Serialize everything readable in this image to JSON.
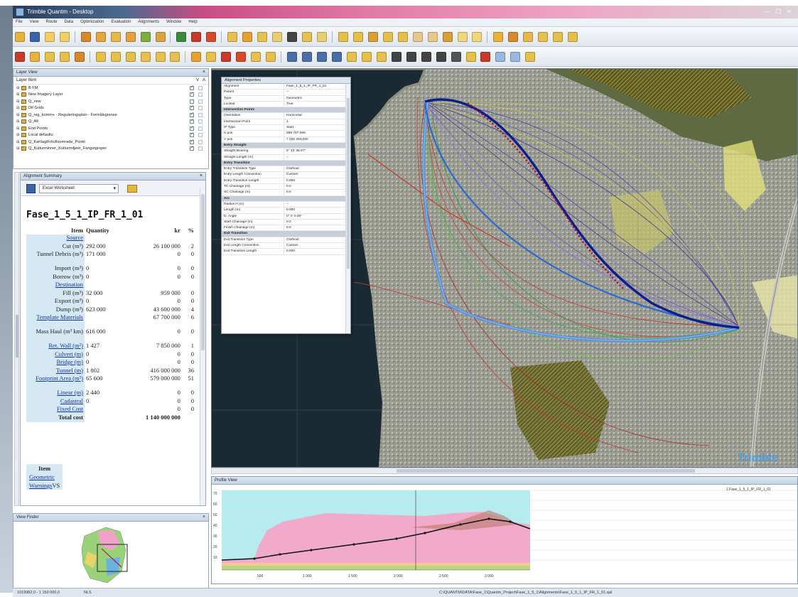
{
  "window": {
    "title": "Trimble Quantm - Desktop"
  },
  "menu": [
    "File",
    "View",
    "Route",
    "Data",
    "Optimization",
    "Evaluation",
    "Alignments",
    "Window",
    "Help"
  ],
  "layer_view": {
    "title": "Layer View",
    "column_header": "Layer Item",
    "column_v": "V",
    "column_a": "A",
    "layers": [
      {
        "name": "B FM",
        "visible": true
      },
      {
        "name": "New Imagery Layer",
        "visible": true
      },
      {
        "name": "Q_new",
        "visible": false
      },
      {
        "name": "Dif Grids",
        "visible": true
      },
      {
        "name": "Q_reg_komm+ - Reguleringsplan - Formålsgrense",
        "visible": true
      },
      {
        "name": "Q_Alt",
        "visible": true
      },
      {
        "name": "End Points",
        "visible": true
      },
      {
        "name": "Local defaults",
        "visible": true
      },
      {
        "name": "Q_KartlagtFriluftsomrade_Punkt",
        "visible": true
      },
      {
        "name": "Q_Kulturminner_Kulturmiljøer_Fangstgroper",
        "visible": true
      }
    ]
  },
  "alignment_summary": {
    "title": "Alignment Summary",
    "export_option": "Excel Worksheet",
    "alignment_name": "Fase_1_5_1_IP_FR_1_01",
    "headers": {
      "item": "Item",
      "quantity": "Quantity",
      "cost": "kr",
      "pct": "%"
    },
    "rows": [
      {
        "label": "Source",
        "link": true,
        "quantity": "",
        "cost": "",
        "pct": ""
      },
      {
        "label": "Cut (m³)",
        "link": false,
        "quantity": "292 000",
        "cost": "26 100 000",
        "pct": "2"
      },
      {
        "label": "Tunnel Debris (m³)",
        "link": false,
        "quantity": "171 000",
        "cost": "0",
        "pct": "0",
        "tall": true
      },
      {
        "label": "Import (m³)",
        "link": false,
        "quantity": "0",
        "cost": "0",
        "pct": "0"
      },
      {
        "label": "Borrow (m³)",
        "link": false,
        "quantity": "0",
        "cost": "0",
        "pct": "0"
      },
      {
        "label": "Destination",
        "link": true,
        "quantity": "",
        "cost": "",
        "pct": ""
      },
      {
        "label": "Fill (m³)",
        "link": false,
        "quantity": "32 000",
        "cost": "959 000",
        "pct": "0"
      },
      {
        "label": "Export (m³)",
        "link": false,
        "quantity": "0",
        "cost": "0",
        "pct": "0"
      },
      {
        "label": "Dump (m³)",
        "link": false,
        "quantity": "623 000",
        "cost": "43 600 000",
        "pct": "4"
      },
      {
        "label": "Template Materials",
        "link": true,
        "quantity": "",
        "cost": "67 700 000",
        "pct": "6",
        "tall": true
      },
      {
        "label": "Mass Haul (m³ km)",
        "link": false,
        "quantity": "616 000",
        "cost": "0",
        "pct": "0",
        "tall": true
      },
      {
        "label": "Ret. Wall (m²)",
        "link": true,
        "quantity": "1 427",
        "cost": "7 850 000",
        "pct": "1"
      },
      {
        "label": "Culvert (m)",
        "link": true,
        "quantity": "0",
        "cost": "0",
        "pct": "0"
      },
      {
        "label": "Bridge (m)",
        "link": true,
        "quantity": "0",
        "cost": "0",
        "pct": "0"
      },
      {
        "label": "Tunnel (m)",
        "link": true,
        "quantity": "1 802",
        "cost": "416 000 000",
        "pct": "36"
      },
      {
        "label": "Footprint Area (m²)",
        "link": true,
        "quantity": "65 600",
        "cost": "579 000 000",
        "pct": "51",
        "tall": true
      },
      {
        "label": "Linear (m)",
        "link": true,
        "quantity": "2 440",
        "cost": "0",
        "pct": "0"
      },
      {
        "label": "Cadastral",
        "link": true,
        "quantity": "0",
        "cost": "0",
        "pct": "0"
      },
      {
        "label": "Fixed Cost",
        "link": true,
        "quantity": "",
        "cost": "0",
        "pct": "0"
      }
    ],
    "total": {
      "label": "Total cost",
      "cost": "1 140 000 000"
    },
    "item_table": {
      "header": "Item",
      "rows": [
        {
          "label": "Geometric",
          "suffix": ""
        },
        {
          "label": "Warnings",
          "suffix": "VS"
        }
      ]
    }
  },
  "overview": {
    "title": "View Finder"
  },
  "properties": {
    "title": "Alignment Properties",
    "rows": [
      {
        "k": "Alignment",
        "v": "Fase_1_5_1_IP_FR_1_01"
      },
      {
        "k": "Parent",
        "v": "--"
      },
      {
        "k": "Type",
        "v": "Geometric"
      },
      {
        "k": "Locked",
        "v": "True"
      },
      {
        "k": "Intersection Points",
        "v": "",
        "section": true
      },
      {
        "k": "Orientation",
        "v": "Horizontal"
      },
      {
        "k": "Intersection Point",
        "v": "1"
      },
      {
        "k": "IP Type",
        "v": "Start"
      },
      {
        "k": "X pos",
        "v": "598 787,069"
      },
      {
        "k": "Y pos",
        "v": "7 035 254,000"
      },
      {
        "k": "Entry Straight",
        "v": "",
        "section": true
      },
      {
        "k": "Straight Bearing",
        "v": "6° 42' 36.97\""
      },
      {
        "k": "Straight Length (m)",
        "v": "--"
      },
      {
        "k": "Entry Transition",
        "v": "",
        "section": true
      },
      {
        "k": "Entry Transition Type",
        "v": "Clothoid"
      },
      {
        "k": "Entry Length Convention",
        "v": "Custom"
      },
      {
        "k": "Entry Transition Length",
        "v": "0.000"
      },
      {
        "k": "TC Chainage (m)",
        "v": "0.0"
      },
      {
        "k": "SC Chainage (m)",
        "v": "0.0"
      },
      {
        "k": "Arc",
        "v": "",
        "section": true
      },
      {
        "k": "Radius H (m)",
        "v": "--"
      },
      {
        "k": "Length (m)",
        "v": "0.000"
      },
      {
        "k": "D. Angle",
        "v": "0° 0' 0.00\""
      },
      {
        "k": "Start Chainage (m)",
        "v": "0.0"
      },
      {
        "k": "Finish Chainage (m)",
        "v": "0.0"
      },
      {
        "k": "Exit Transition",
        "v": "",
        "section": true
      },
      {
        "k": "Exit Transition Type",
        "v": "Clothoid"
      },
      {
        "k": "Exit Length Convention",
        "v": "Custom"
      },
      {
        "k": "Exit Transition Length",
        "v": "0.000"
      }
    ]
  },
  "map": {
    "watermark": "Trimble"
  },
  "profile": {
    "title": "Profile View",
    "legend": "1 Fase_1_5_1_IP_FR_1_01",
    "y_ticks": [
      "70",
      "60",
      "50",
      "40",
      "30",
      "20",
      "10"
    ],
    "x_ticks": [
      "500",
      "1 000",
      "1 500",
      "2 000",
      "2 500",
      "3 000"
    ]
  },
  "status": {
    "coords": "1019982,0 - 1 150 000,0",
    "mode": "NLS",
    "path": "C:\\QUANTM\\DATA\\Fase_1\\Quantm_Project\\Fase_1_5_1\\Alignments\\Fase_1_5_1_IP_FR_1_01.qal"
  },
  "colors": {
    "accent": "#3a63a8",
    "alignment_main": "#0a1f8f",
    "alignment_highlight": "#4d8fe0",
    "profile_fill": "#f6a6c8",
    "profile_sky": "#b5ecf0"
  }
}
